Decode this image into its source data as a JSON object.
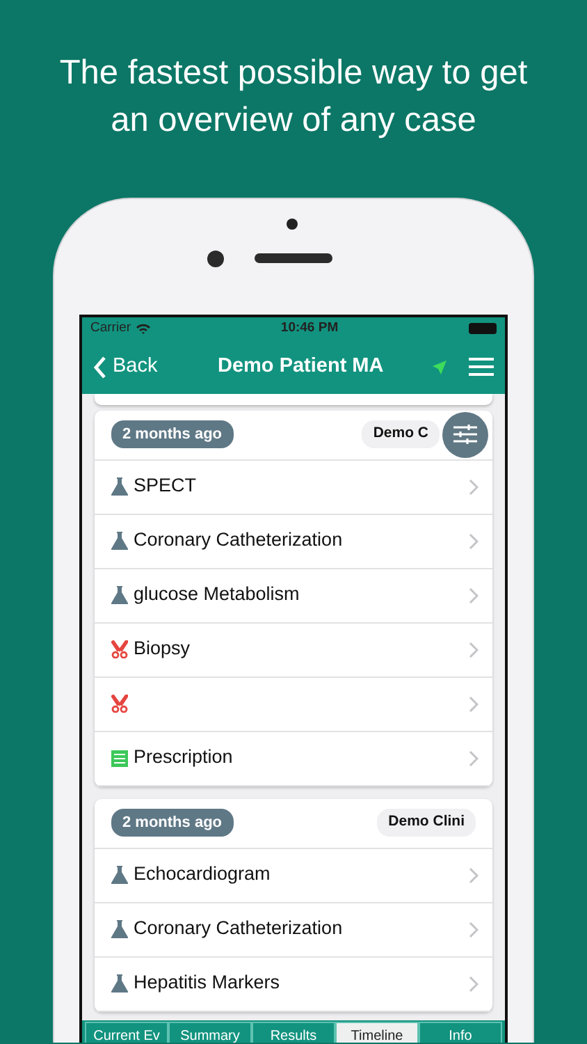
{
  "headline": "The fastest possible way to get an overview of any case",
  "status_bar": {
    "carrier": "Carrier",
    "time": "10:46 PM"
  },
  "nav": {
    "back": "Back",
    "title": "Demo Patient MA"
  },
  "groups": [
    {
      "time": "2 months ago",
      "source": "Demo C",
      "items": [
        {
          "kind": "lab",
          "label": "SPECT"
        },
        {
          "kind": "lab",
          "label": "Coronary Catheterization"
        },
        {
          "kind": "lab",
          "label": "glucose Metabolism"
        },
        {
          "kind": "procedure",
          "label": "Biopsy"
        },
        {
          "kind": "procedure"
        },
        {
          "kind": "prescription",
          "label": "Prescription"
        }
      ]
    },
    {
      "time": "2 months ago",
      "source": "Demo Clini",
      "items": [
        {
          "kind": "lab",
          "label": "Echocardiogram"
        },
        {
          "kind": "lab",
          "label": "Coronary Catheterization"
        },
        {
          "kind": "lab",
          "label": "Hepatitis Markers"
        }
      ]
    }
  ],
  "tabs": [
    {
      "label": "Current Ev",
      "selected": false
    },
    {
      "label": "Summary",
      "selected": false
    },
    {
      "label": "Results",
      "selected": false
    },
    {
      "label": "Timeline",
      "selected": true
    },
    {
      "label": "Info",
      "selected": false
    }
  ]
}
